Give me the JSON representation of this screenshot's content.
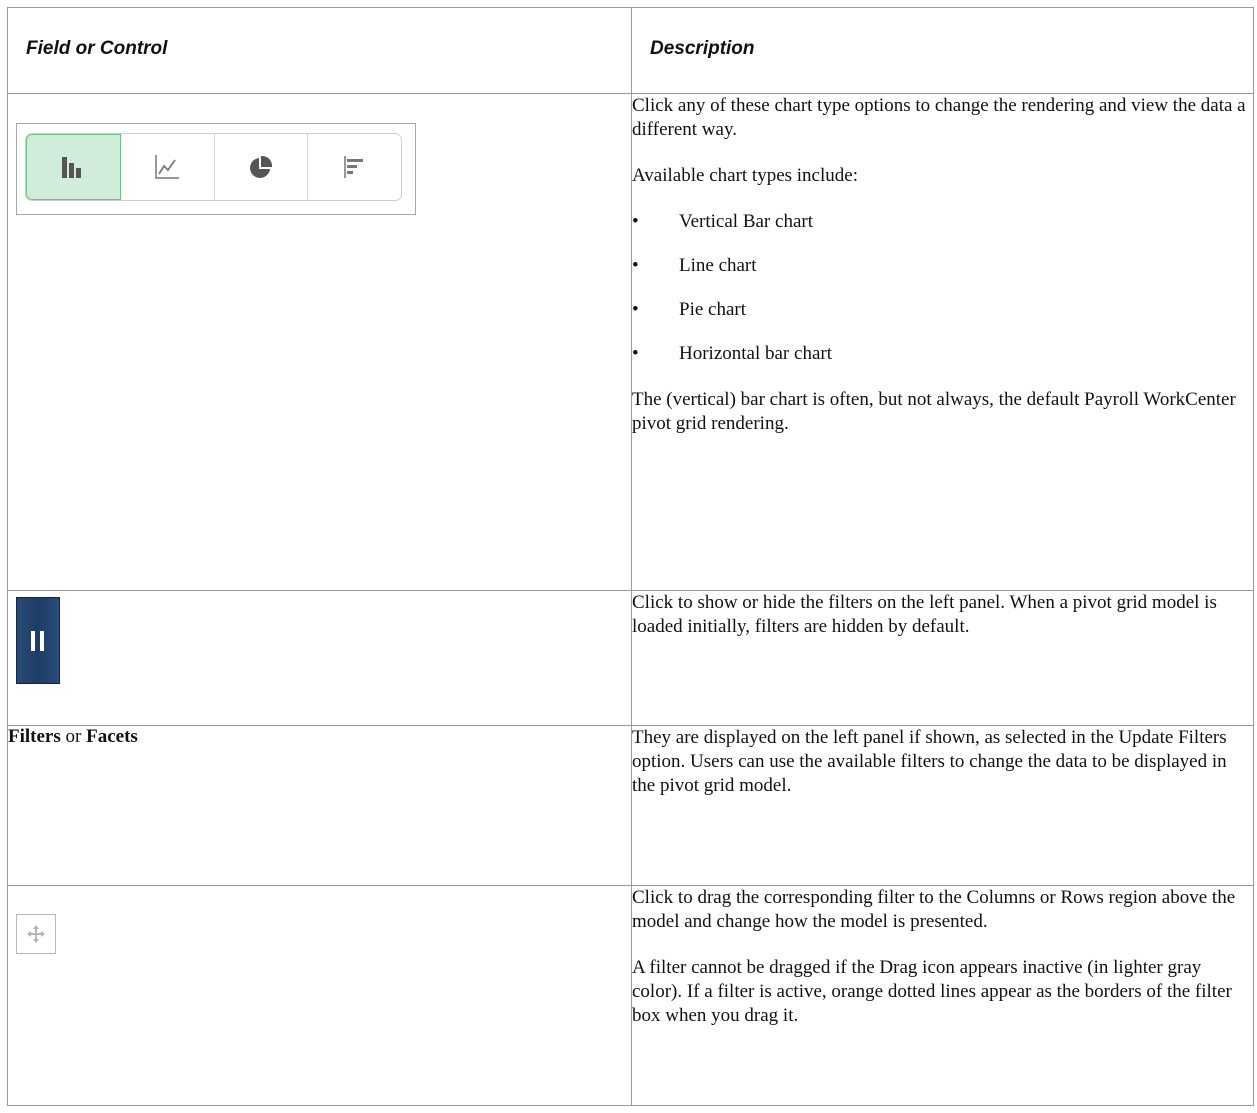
{
  "table": {
    "header_col1": "Field or Control",
    "header_col2": "Description"
  },
  "row1": {
    "toolbar": {
      "buttons": [
        {
          "icon": "vertical-bar-chart-icon",
          "selected": true
        },
        {
          "icon": "line-chart-icon",
          "selected": false
        },
        {
          "icon": "pie-chart-icon",
          "selected": false
        },
        {
          "icon": "horizontal-bar-chart-icon",
          "selected": false
        }
      ],
      "selected_color": "#d1ecd9",
      "selected_border": "#6cc08a"
    },
    "para1": "Click any of these chart type options to change the rendering and view the data a different way.",
    "para2": "Available chart types include:",
    "bullet_char": "•",
    "bullets": [
      "Vertical Bar chart",
      "Line chart",
      "Pie chart",
      "Horizontal bar chart"
    ],
    "para3": "The (vertical) bar chart is often, but not always, the default Payroll WorkCenter pivot grid rendering."
  },
  "row2": {
    "icon": "pause-toggle-icon",
    "button_color": "#1d3c66",
    "desc": "Click to show or hide the filters on the left panel. When a pivot grid model is loaded initially, filters are hidden by default."
  },
  "row3": {
    "label_a": "Filters",
    "label_join": " or ",
    "label_b": "Facets",
    "desc": "They are displayed on the left panel if shown, as selected in the Update Filters option. Users can use the available filters to change the data to be displayed in the pivot grid model."
  },
  "row4": {
    "icon": "drag-move-icon",
    "desc1": "Click to drag the corresponding filter to the Columns or Rows region above the model and change how the model is presented.",
    "desc2": "A filter cannot be dragged if the Drag icon appears inactive (in lighter gray color). If a filter is active, orange dotted lines appear as the borders of the filter box when you drag it."
  }
}
